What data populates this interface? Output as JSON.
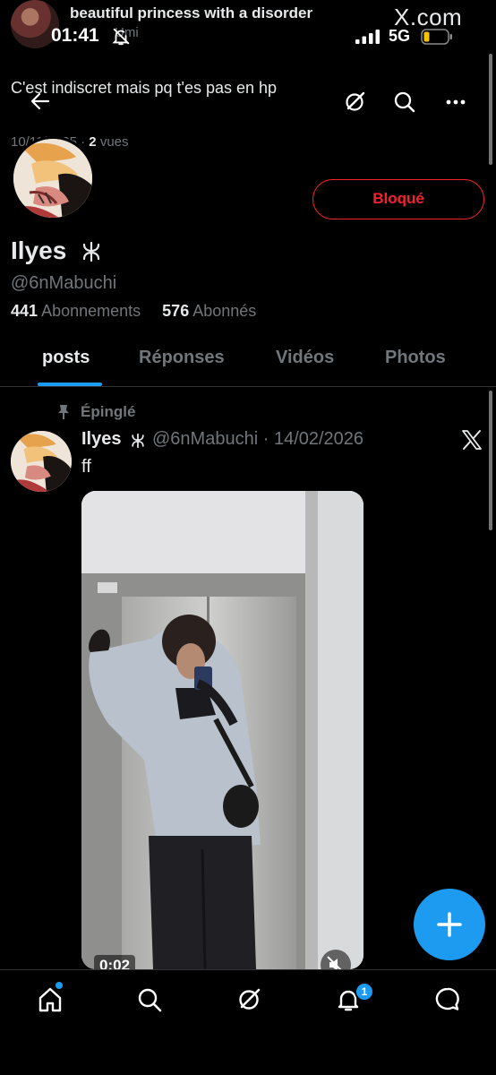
{
  "background_tweet": {
    "name": "beautiful princess with a disorder",
    "handle": "Umi",
    "text": "C'est indiscret mais pq t'es pas en hp",
    "date": "10/11/2025 ·",
    "views_count": "2",
    "views_label": "vues"
  },
  "status_bar": {
    "time": "01:41",
    "network": "5G",
    "site_label": "X.com"
  },
  "profile": {
    "name": "Ilyes",
    "handle": "@6nMabuchi",
    "following_count": "441",
    "following_label": "Abonnements",
    "followers_count": "576",
    "followers_label": "Abonnés",
    "block_button": "Bloqué"
  },
  "tabs": [
    {
      "label": "posts",
      "active": true
    },
    {
      "label": "Réponses",
      "active": false
    },
    {
      "label": "Vidéos",
      "active": false
    },
    {
      "label": "Photos",
      "active": false
    }
  ],
  "pinned_post": {
    "pinned_label": "Épinglé",
    "author_name": "Ilyes",
    "author_handle": "@6nMabuchi",
    "separator": "·",
    "date": "14/02/2026",
    "text": "ff",
    "video_duration": "0:02"
  },
  "bottom_nav": {
    "notifications_badge": "1"
  },
  "colors": {
    "accent": "#1d9bf0",
    "danger": "#f4212e",
    "secondary_text": "#71767b",
    "primary_text": "#e7e9ea"
  },
  "icons": [
    "back-arrow-icon",
    "grok-icon",
    "search-icon",
    "more-icon",
    "pin-icon",
    "x-logo-icon",
    "mute-icon",
    "plus-icon",
    "home-icon",
    "notifications-icon",
    "messages-icon"
  ]
}
